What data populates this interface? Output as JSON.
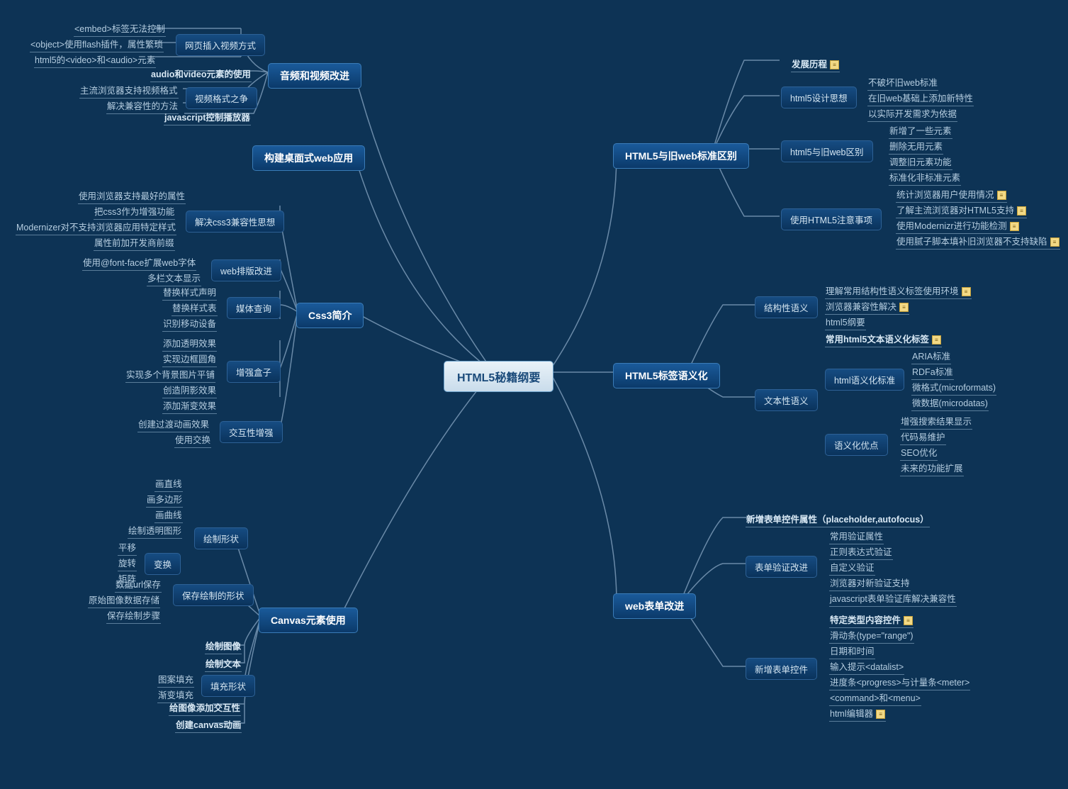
{
  "root": "HTML5秘籍纲要",
  "left": {
    "audio": {
      "title": "音频和视频改进",
      "sub_insert": {
        "title": "网页插入视频方式",
        "items": [
          "<embed>标签无法控制",
          "<object>使用flash插件，属性繁琐",
          "html5的<video>和<audio>元素"
        ]
      },
      "leaf_use": "audio和video元素的使用",
      "sub_format": {
        "title": "视频格式之争",
        "items": [
          "主流浏览器支持视频格式",
          "解决兼容性的方法"
        ]
      },
      "leaf_js": "javascript控制播放器"
    },
    "desktop": "构建桌面式web应用",
    "css3": {
      "title": "Css3简介",
      "sub_compat": {
        "title": "解决css3兼容性思想",
        "items": [
          "使用浏览器支持最好的属性",
          "把css3作为增强功能",
          "Modernizer对不支持浏览器应用特定样式",
          "属性前加开发商前缀"
        ]
      },
      "sub_type": {
        "title": "web排版改进",
        "items": [
          "使用@font-face扩展web字体",
          "多栏文本显示"
        ]
      },
      "sub_media": {
        "title": "媒体查询",
        "items": [
          "替换样式声明",
          "替换样式表",
          "识别移动设备"
        ]
      },
      "sub_box": {
        "title": "增强盒子",
        "items": [
          "添加透明效果",
          "实现边框圆角",
          "实现多个背景图片平铺",
          "创造阴影效果",
          "添加渐变效果"
        ]
      },
      "sub_inter": {
        "title": "交互性增强",
        "items": [
          "创建过渡动画效果",
          "使用交换"
        ]
      }
    },
    "canvas": {
      "title": "Canvas元素使用",
      "sub_shape": {
        "title": "绘制形状",
        "trans": {
          "title": "变换",
          "items": [
            "平移",
            "旋转",
            "矩阵"
          ]
        },
        "items": [
          "画直线",
          "画多边形",
          "画曲线",
          "绘制透明图形"
        ]
      },
      "sub_save": {
        "title": "保存绘制的形状",
        "items": [
          "数据url保存",
          "原始图像数据存储",
          "保存绘制步骤"
        ]
      },
      "leaf_img": "绘制图像",
      "leaf_txt": "绘制文本",
      "sub_fill": {
        "title": "填充形状",
        "items": [
          "图案填充",
          "渐变填充"
        ]
      },
      "leaf_interact": "给图像添加交互性",
      "leaf_anim": "创建canvas动画"
    }
  },
  "right": {
    "diff": {
      "title": "HTML5与旧web标准区别",
      "leaf_hist": "发展历程",
      "sub_design": {
        "title": "html5设计思想",
        "items": [
          "不破坏旧web标准",
          "在旧web基础上添加新特性",
          "以实际开发需求为依据"
        ]
      },
      "sub_vs": {
        "title": "html5与旧web区别",
        "items": [
          "新增了一些元素",
          "删除无用元素",
          "调整旧元素功能",
          "标准化非标准元素"
        ]
      },
      "sub_note": {
        "title": "使用HTML5注意事项",
        "items": [
          "统计浏览器用户使用情况",
          "了解主流浏览器对HTML5支持",
          "使用Modernizr进行功能检测",
          "使用腻子脚本填补旧浏览器不支持缺陷"
        ]
      }
    },
    "semantic": {
      "title": "HTML5标签语义化",
      "sub_struct": {
        "title": "结构性语义",
        "items": [
          "理解常用结构性语义标签使用环境",
          "浏览器兼容性解决",
          "html5纲要"
        ]
      },
      "sub_text": {
        "title": "文本性语义",
        "leaf_common": "常用html5文本语义化标签",
        "std": {
          "title": "html语义化标准",
          "items": [
            "ARIA标准",
            "RDFa标准",
            "微格式(microformats)",
            "微数据(microdatas)"
          ]
        },
        "adv": {
          "title": "语义化优点",
          "items": [
            "增强搜索结果显示",
            "代码易维护",
            "SEO优化",
            "未来的功能扩展"
          ]
        }
      }
    },
    "form": {
      "title": "web表单改进",
      "leaf_new": "新增表单控件属性（placeholder,autofocus）",
      "sub_valid": {
        "title": "表单验证改进",
        "items": [
          "常用验证属性",
          "正则表达式验证",
          "自定义验证",
          "浏览器对新验证支持",
          "javascript表单验证库解决兼容性"
        ]
      },
      "sub_ctrl": {
        "title": "新增表单控件",
        "items": [
          "特定类型内容控件",
          "滑动条(type=\"range\")",
          "日期和时间",
          "输入提示<datalist>",
          "进度条<progress>与计量条<meter>",
          "<command>和<menu>",
          "html编辑器"
        ]
      }
    }
  }
}
